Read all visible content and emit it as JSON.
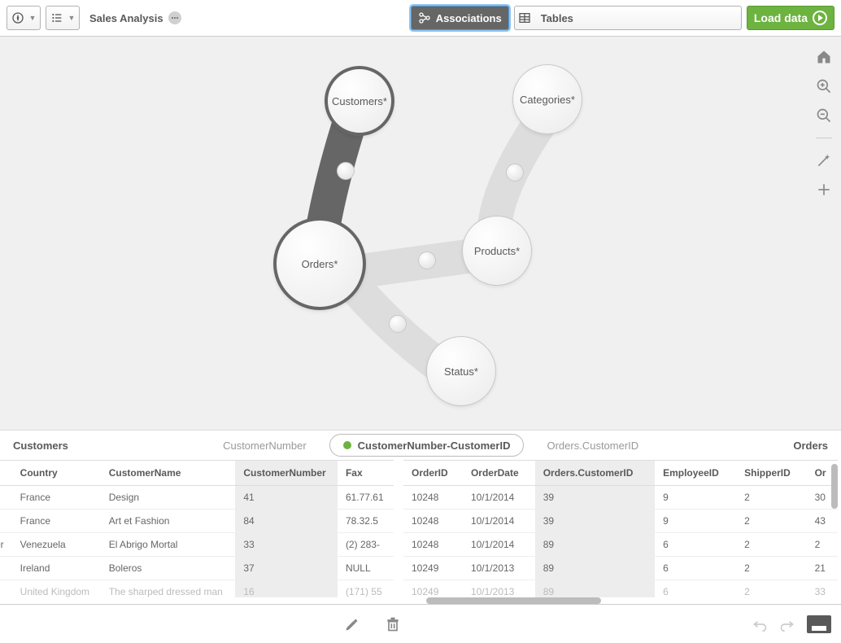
{
  "header": {
    "title": "Sales Analysis",
    "assoc": "Associations",
    "tables": "Tables",
    "load": "Load data"
  },
  "bubbles": {
    "customers": "Customers*",
    "categories": "Categories*",
    "orders": "Orders*",
    "products": "Products*",
    "status": "Status*"
  },
  "assocBar": {
    "leftTable": "Customers",
    "leftField": "CustomerNumber",
    "pill": "CustomerNumber-CustomerID",
    "rightField": "Orders.CustomerID",
    "rightTable": "Orders"
  },
  "leftTable": {
    "headers": [
      "Country",
      "CustomerName",
      "CustomerNumber",
      "Fax"
    ],
    "rows": [
      [
        "",
        "France",
        "Design",
        "41",
        "61.77.61"
      ],
      [
        "",
        "France",
        "Art et Fashion",
        "84",
        "78.32.5"
      ],
      [
        "mer",
        "Venezuela",
        "El Abrigo Mortal",
        "33",
        "(2) 283-"
      ],
      [
        "",
        "Ireland",
        "Boleros",
        "37",
        "NULL"
      ],
      [
        "",
        "United Kingdom",
        "The sharped dressed man",
        "16",
        "(171) 55"
      ]
    ]
  },
  "rightTable": {
    "headers": [
      "OrderID",
      "OrderDate",
      "Orders.CustomerID",
      "EmployeeID",
      "ShipperID",
      "Or"
    ],
    "rows": [
      [
        "10248",
        "10/1/2014",
        "39",
        "9",
        "2",
        "30"
      ],
      [
        "10248",
        "10/1/2014",
        "39",
        "9",
        "2",
        "43"
      ],
      [
        "10248",
        "10/1/2014",
        "89",
        "6",
        "2",
        "2"
      ],
      [
        "10249",
        "10/1/2013",
        "89",
        "6",
        "2",
        "21"
      ],
      [
        "10249",
        "10/1/2013",
        "89",
        "6",
        "2",
        "33"
      ]
    ]
  }
}
